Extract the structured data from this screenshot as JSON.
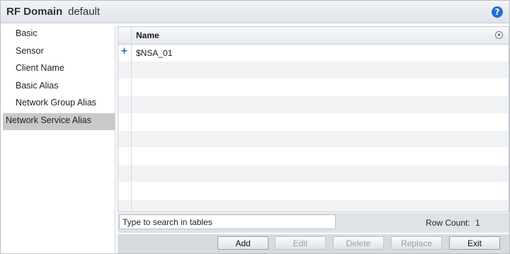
{
  "header": {
    "title": "RF Domain",
    "subtitle": "default",
    "help_icon": "?"
  },
  "sidebar": {
    "items": [
      {
        "label": "Basic"
      },
      {
        "label": "Sensor"
      },
      {
        "label": "Client Name"
      },
      {
        "label": "Basic Alias"
      },
      {
        "label": "Network Group Alias"
      },
      {
        "label": "Network Service Alias",
        "active": true
      }
    ]
  },
  "table": {
    "columns": [
      "Name"
    ],
    "rows": [
      {
        "name": "$NSA_01",
        "expand_icon": "+"
      }
    ]
  },
  "search": {
    "placeholder": "Type to search in tables",
    "value": "Type to search in tables"
  },
  "row_count": {
    "label": "Row Count:",
    "value": "1"
  },
  "buttons": {
    "add": "Add",
    "edit": "Edit",
    "delete": "Delete",
    "replace": "Replace",
    "exit": "Exit"
  },
  "colors": {
    "accent": "#1f6fcf",
    "active_nav": "#c9c9c9",
    "bar": "#dfe3e8"
  }
}
